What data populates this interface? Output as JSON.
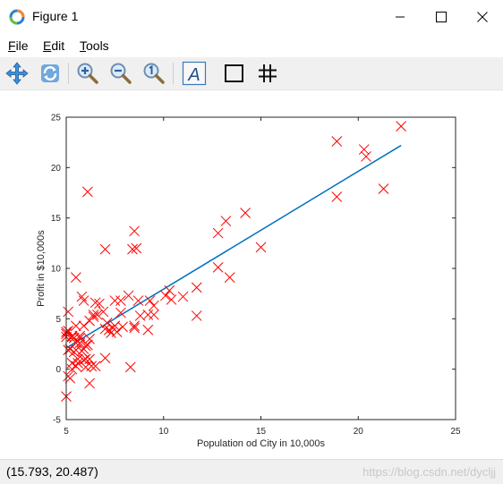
{
  "window": {
    "title": "Figure 1"
  },
  "menu": {
    "file": "File",
    "edit": "Edit",
    "tools": "Tools"
  },
  "toolbar": {
    "buttons": [
      {
        "icon": "pan-icon"
      },
      {
        "icon": "rotate-icon"
      },
      {
        "icon": "zoom-in-icon"
      },
      {
        "icon": "zoom-out-icon"
      },
      {
        "icon": "zoom-reset-icon"
      },
      {
        "icon": "text-insert-icon"
      },
      {
        "icon": "box-toggle-icon"
      },
      {
        "icon": "grid-toggle-icon"
      }
    ]
  },
  "status": {
    "coordinates": "(15.793, 20.487)"
  },
  "watermark": "https://blog.csdn.net/dycljj",
  "colors": {
    "marker": "#ff0000",
    "fit_line": "#0072bd",
    "toolbar_bg": "#f0f0f0"
  },
  "chart_data": {
    "type": "scatter",
    "title": "",
    "xlabel": "Population od City in 10,000s",
    "ylabel": "Profit in $10,000s",
    "xlim": [
      5,
      25
    ],
    "ylim": [
      -5,
      25
    ],
    "xticks": [
      "5",
      "10",
      "15",
      "20",
      "25"
    ],
    "yticks": [
      "-5",
      "0",
      "5",
      "10",
      "15",
      "20",
      "25"
    ],
    "grid": false,
    "series": [
      {
        "marker": "x",
        "points": [
          [
            6.1,
            17.6
          ],
          [
            5.5,
            9.1
          ],
          [
            8.5,
            13.7
          ],
          [
            7.0,
            11.9
          ],
          [
            5.9,
            6.8
          ],
          [
            8.4,
            11.9
          ],
          [
            7.5,
            4.3
          ],
          [
            8.6,
            12.0
          ],
          [
            6.5,
            6.6
          ],
          [
            5.1,
            3.8
          ],
          [
            5.7,
            3.3
          ],
          [
            14.2,
            15.5
          ],
          [
            5.7,
            3.1
          ],
          [
            6.2,
            -1.4
          ],
          [
            5.5,
            4.3
          ],
          [
            5.3,
            3.3
          ],
          [
            5.4,
            3.1
          ],
          [
            5.0,
            3.2
          ],
          [
            5.5,
            1.9
          ],
          [
            5.0,
            3.5
          ],
          [
            5.1,
            1.9
          ],
          [
            5.3,
            3.2
          ],
          [
            5.0,
            3.7
          ],
          [
            5.5,
            0.3
          ],
          [
            6.0,
            2.3
          ],
          [
            5.2,
            -0.9
          ],
          [
            6.1,
            2.4
          ],
          [
            7.2,
            3.9
          ],
          [
            7.4,
            4.1
          ],
          [
            7.5,
            6.8
          ],
          [
            7.8,
            6.8
          ],
          [
            8.2,
            7.3
          ],
          [
            8.8,
            5.3
          ],
          [
            9.3,
            6.8
          ],
          [
            10.1,
            7.3
          ],
          [
            10.3,
            7.8
          ],
          [
            10.4,
            6.9
          ],
          [
            11.0,
            7.2
          ],
          [
            11.7,
            5.3
          ],
          [
            11.7,
            8.1
          ],
          [
            12.8,
            13.5
          ],
          [
            12.8,
            10.1
          ],
          [
            13.2,
            14.7
          ],
          [
            13.4,
            9.1
          ],
          [
            15.0,
            12.1
          ],
          [
            18.9,
            17.1
          ],
          [
            18.9,
            22.6
          ],
          [
            20.3,
            21.8
          ],
          [
            20.4,
            21.1
          ],
          [
            21.3,
            17.9
          ],
          [
            22.2,
            24.1
          ],
          [
            5.9,
            0.9
          ],
          [
            6.3,
            0.3
          ],
          [
            5.6,
            0.6
          ],
          [
            5.0,
            -2.7
          ],
          [
            5.1,
            5.7
          ],
          [
            6.5,
            0.3
          ],
          [
            5.3,
            0.0
          ],
          [
            5.6,
            1.0
          ],
          [
            5.8,
            1.8
          ],
          [
            6.2,
            1.0
          ],
          [
            6.0,
            0.2
          ],
          [
            7.0,
            1.1
          ],
          [
            8.3,
            0.2
          ],
          [
            9.2,
            5.4
          ],
          [
            9.5,
            6.3
          ],
          [
            5.7,
            2.6
          ],
          [
            6.4,
            5.4
          ],
          [
            6.6,
            5.4
          ],
          [
            7.9,
            4.2
          ],
          [
            8.5,
            4.3
          ],
          [
            9.2,
            3.9
          ],
          [
            6.2,
            4.8
          ],
          [
            7.1,
            4.6
          ],
          [
            7.6,
            3.7
          ],
          [
            6.4,
            5.2
          ],
          [
            6.9,
            5.7
          ],
          [
            5.4,
            1.7
          ],
          [
            5.9,
            2.0
          ],
          [
            5.2,
            2.0
          ],
          [
            6.7,
            6.5
          ],
          [
            5.8,
            7.2
          ],
          [
            7.8,
            5.6
          ],
          [
            9.5,
            5.4
          ],
          [
            7.0,
            4.0
          ],
          [
            6.2,
            3.0
          ],
          [
            5.9,
            4.3
          ],
          [
            5.1,
            -0.7
          ],
          [
            6.0,
            1.0
          ],
          [
            7.3,
            3.6
          ],
          [
            8.5,
            4.1
          ],
          [
            8.7,
            6.8
          ],
          [
            5.5,
            2.6
          ],
          [
            5.3,
            0.6
          ]
        ]
      }
    ],
    "fit_line": {
      "x": [
        5.0,
        22.2
      ],
      "y": [
        2.1,
        22.2
      ]
    }
  }
}
